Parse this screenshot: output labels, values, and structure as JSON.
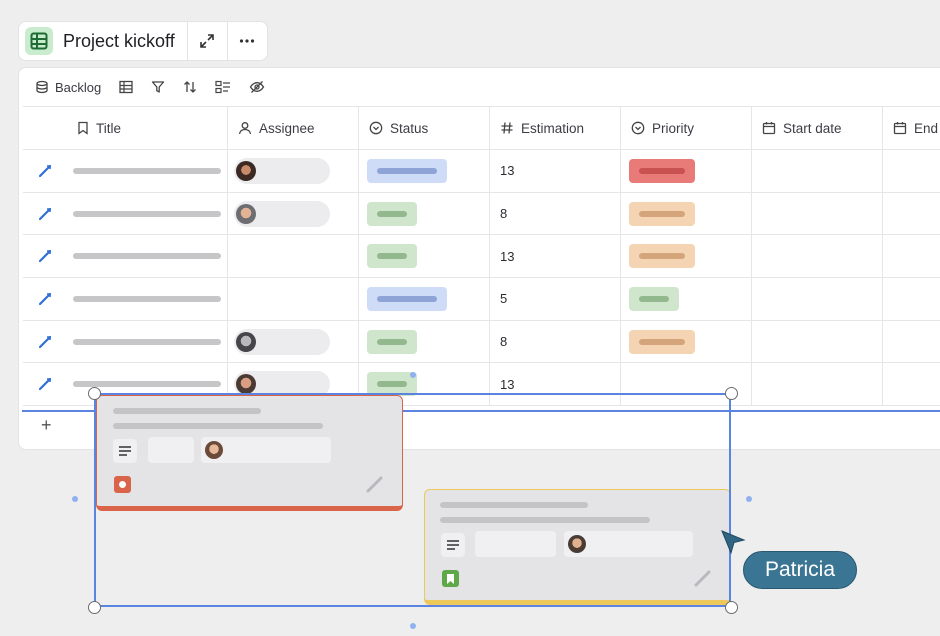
{
  "title_bar": {
    "title": "Project kickoff",
    "expand_icon": "expand-icon",
    "more_icon": "more-icon"
  },
  "toolbar": {
    "view_label": "Backlog",
    "icons": [
      "database-icon",
      "table-icon",
      "filter-icon",
      "sort-icon",
      "group-icon",
      "hide-icon"
    ]
  },
  "columns": [
    {
      "label": "Title",
      "icon": "bookmark-icon"
    },
    {
      "label": "Assignee",
      "icon": "person-icon"
    },
    {
      "label": "Status",
      "icon": "status-icon"
    },
    {
      "label": "Estimation",
      "icon": "hash-icon"
    },
    {
      "label": "Priority",
      "icon": "priority-icon"
    },
    {
      "label": "Start date",
      "icon": "calendar-icon"
    },
    {
      "label": "End d",
      "icon": "calendar-icon"
    }
  ],
  "rows": [
    {
      "estimation": "13",
      "assignee": true,
      "status": "blue",
      "priority": "red"
    },
    {
      "estimation": "8",
      "assignee": true,
      "status": "green",
      "priority": "orange"
    },
    {
      "estimation": "13",
      "assignee": false,
      "status": "green",
      "priority": "orange"
    },
    {
      "estimation": "5",
      "assignee": false,
      "status": "blue",
      "priority": "green"
    },
    {
      "estimation": "8",
      "assignee": true,
      "status": "green",
      "priority": "orange"
    },
    {
      "estimation": "13",
      "assignee": true,
      "status": "green",
      "priority": "none"
    }
  ],
  "add_row": {
    "icon": "plus-icon"
  },
  "cursor": {
    "user": "Patricia",
    "color": "#3b7594"
  },
  "colors": {
    "blue_chip": "#cfdcf8",
    "blue_bar": "#8ea3d6",
    "green_chip": "#cfe6cc",
    "green_bar": "#92b98d",
    "orange_chip": "#f5d4b3",
    "orange_bar": "#d4a47a",
    "red_chip": "#e87a78",
    "red_bar": "#c9514f",
    "selection": "#5b83e0",
    "card_red": "#d9644a",
    "card_yellow": "#ecc95a"
  }
}
